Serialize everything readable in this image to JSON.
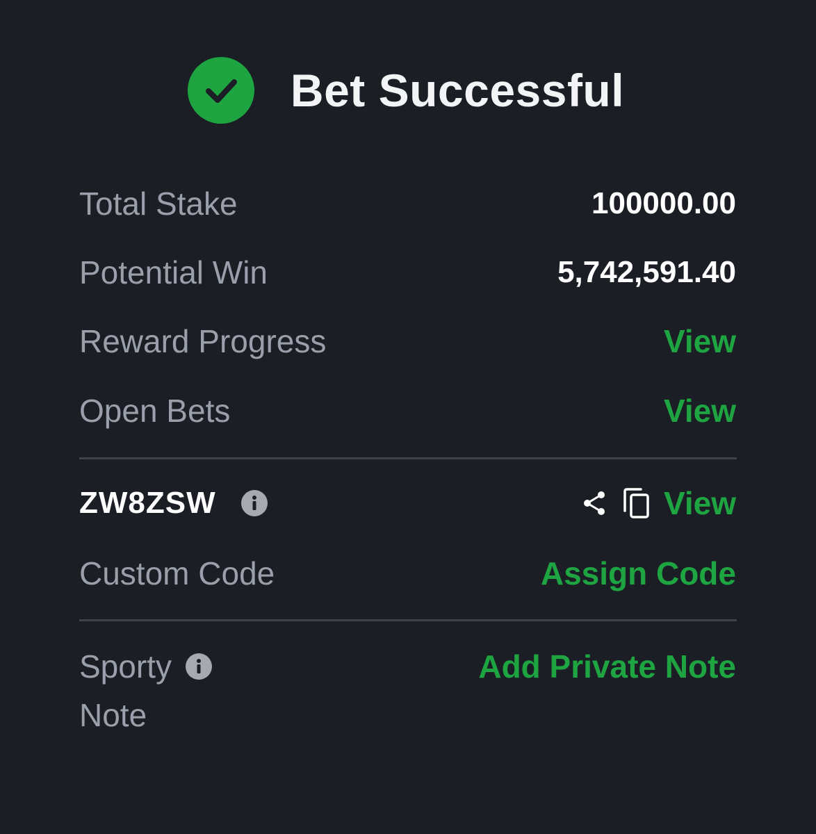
{
  "header": {
    "title": "Bet Successful",
    "icon": "check-circle-icon",
    "accent_color": "#1ea441"
  },
  "summary": {
    "total_stake_label": "Total Stake",
    "total_stake_value": "100000.00",
    "potential_win_label": "Potential Win",
    "potential_win_value": "5,742,591.40",
    "reward_progress_label": "Reward Progress",
    "reward_progress_link": "View",
    "open_bets_label": "Open Bets",
    "open_bets_link": "View"
  },
  "booking": {
    "code": "ZW8ZSW",
    "info_icon": "info-icon",
    "share_icon": "share-icon",
    "copy_icon": "copy-icon",
    "view_link": "View",
    "custom_code_label": "Custom Code",
    "assign_code_link": "Assign Code"
  },
  "note": {
    "label_line1": "Sporty",
    "label_line2": "Note",
    "info_icon": "info-icon",
    "add_note_link": "Add Private Note"
  },
  "colors": {
    "background": "#1b1e25",
    "label": "#9aa0ab",
    "value": "#ffffff",
    "link": "#1ea441",
    "divider": "#3e434e"
  }
}
